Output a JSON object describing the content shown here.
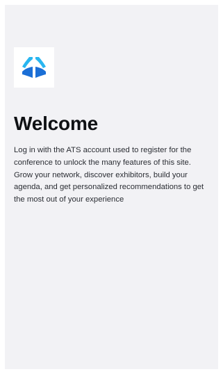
{
  "colors": {
    "background": "#f2f2f5",
    "logo_tile": "#ffffff",
    "logo_accent_dark": "#1b6fd6",
    "logo_accent_light": "#29b6f0",
    "heading": "#0f1114",
    "body_text": "#2a2d33"
  },
  "logo": {
    "icon": "lungs-logo-icon"
  },
  "welcome": {
    "title": "Welcome",
    "description": "Log in with the ATS account used to register for the conference to unlock the many features of this site. Grow your network, discover exhibitors, build your agenda, and get personalized recommendations to get the most out of your experience"
  }
}
